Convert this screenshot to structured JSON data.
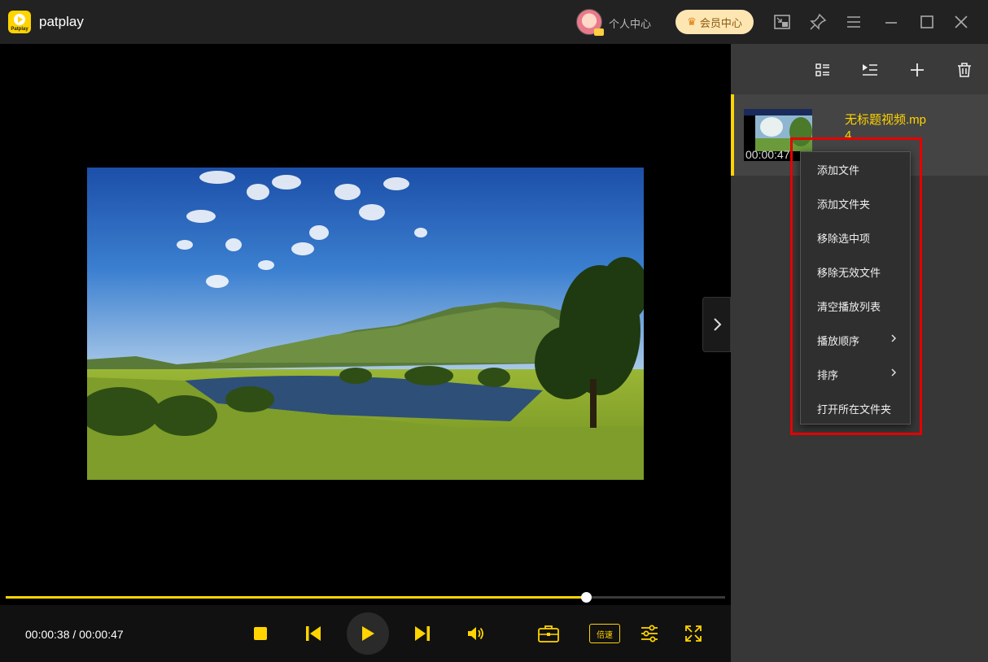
{
  "app": {
    "name": "patplay",
    "logo_text": "Patplay"
  },
  "titlebar": {
    "personal_center": "个人中心",
    "vip_center": "会员中心",
    "icons": [
      "mini-player-icon",
      "pin-icon",
      "menu-icon",
      "minimize-icon",
      "maximize-icon",
      "close-icon"
    ]
  },
  "player": {
    "time_display": "00:00:38 / 00:00:47",
    "progress": 0.807,
    "speed_label": "倍速"
  },
  "playlist": {
    "items": [
      {
        "title": "无标题视频.mp4",
        "duration": "00:00:47"
      }
    ]
  },
  "context_menu": {
    "items": [
      {
        "label": "添加文件",
        "submenu": false
      },
      {
        "label": "添加文件夹",
        "submenu": false
      },
      {
        "label": "移除选中项",
        "submenu": false
      },
      {
        "label": "移除无效文件",
        "submenu": false
      },
      {
        "label": "清空播放列表",
        "submenu": false
      },
      {
        "label": "播放顺序",
        "submenu": true
      },
      {
        "label": "排序",
        "submenu": true
      },
      {
        "label": "打开所在文件夹",
        "submenu": false
      }
    ]
  },
  "colors": {
    "accent": "#ffd400",
    "highlight_box": "#e50000",
    "background": "#1e1e1e"
  }
}
